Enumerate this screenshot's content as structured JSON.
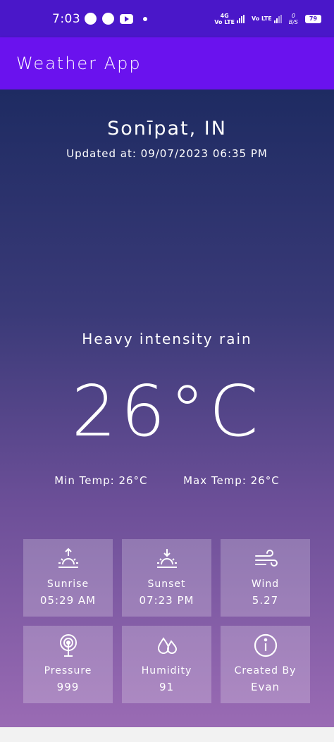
{
  "status_bar": {
    "time": "7:03",
    "net1_label": "Vo LTE",
    "net1_tech": "4G",
    "net2_label": "Vo LTE",
    "speed_value": "0",
    "speed_unit": "B/S",
    "battery": "79"
  },
  "app": {
    "title": "Weather App"
  },
  "weather": {
    "city": "Sonīpat, IN",
    "updated": "Updated at: 09/07/2023 06:35 PM",
    "condition": "Heavy intensity rain",
    "temp": "26°C",
    "min_temp": "Min Temp: 26°C",
    "max_temp": "Max Temp: 26°C"
  },
  "cards": [
    {
      "icon": "sunrise-icon",
      "label": "Sunrise",
      "value": "05:29 AM"
    },
    {
      "icon": "sunset-icon",
      "label": "Sunset",
      "value": "07:23 PM"
    },
    {
      "icon": "wind-icon",
      "label": "Wind",
      "value": "5.27"
    },
    {
      "icon": "pressure-icon",
      "label": "Pressure",
      "value": "999"
    },
    {
      "icon": "humidity-icon",
      "label": "Humidity",
      "value": "91"
    },
    {
      "icon": "info-icon",
      "label": "Created By",
      "value": "Evan"
    }
  ],
  "colors": {
    "status_bar": "#4a17c9",
    "app_bar": "#6a12ee",
    "gradient_top": "#1e2b62",
    "gradient_bottom": "#9a6bb4"
  }
}
